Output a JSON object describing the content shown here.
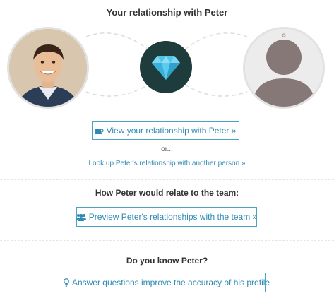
{
  "header": {
    "title": "Your relationship with Peter"
  },
  "avatars": {
    "person_photo": "person-photo",
    "placeholder": "user-placeholder-icon",
    "center": "diamond-icon"
  },
  "actions": {
    "view_relationship": "View your relationship with Peter »",
    "or_text": "or...",
    "lookup_link": "Look up Peter's relationship with another person »"
  },
  "team": {
    "heading": "How Peter would relate to the team:",
    "preview_button": "Preview Peter's relationships with the team »"
  },
  "know": {
    "heading": "Do you know Peter?",
    "answer_button": "Answer questions improve the accuracy of his profile"
  },
  "colors": {
    "accent": "#2f8ab3",
    "gem_bg": "#1f3c3c",
    "gem": "#4fc3e8",
    "placeholder": "#857876"
  }
}
